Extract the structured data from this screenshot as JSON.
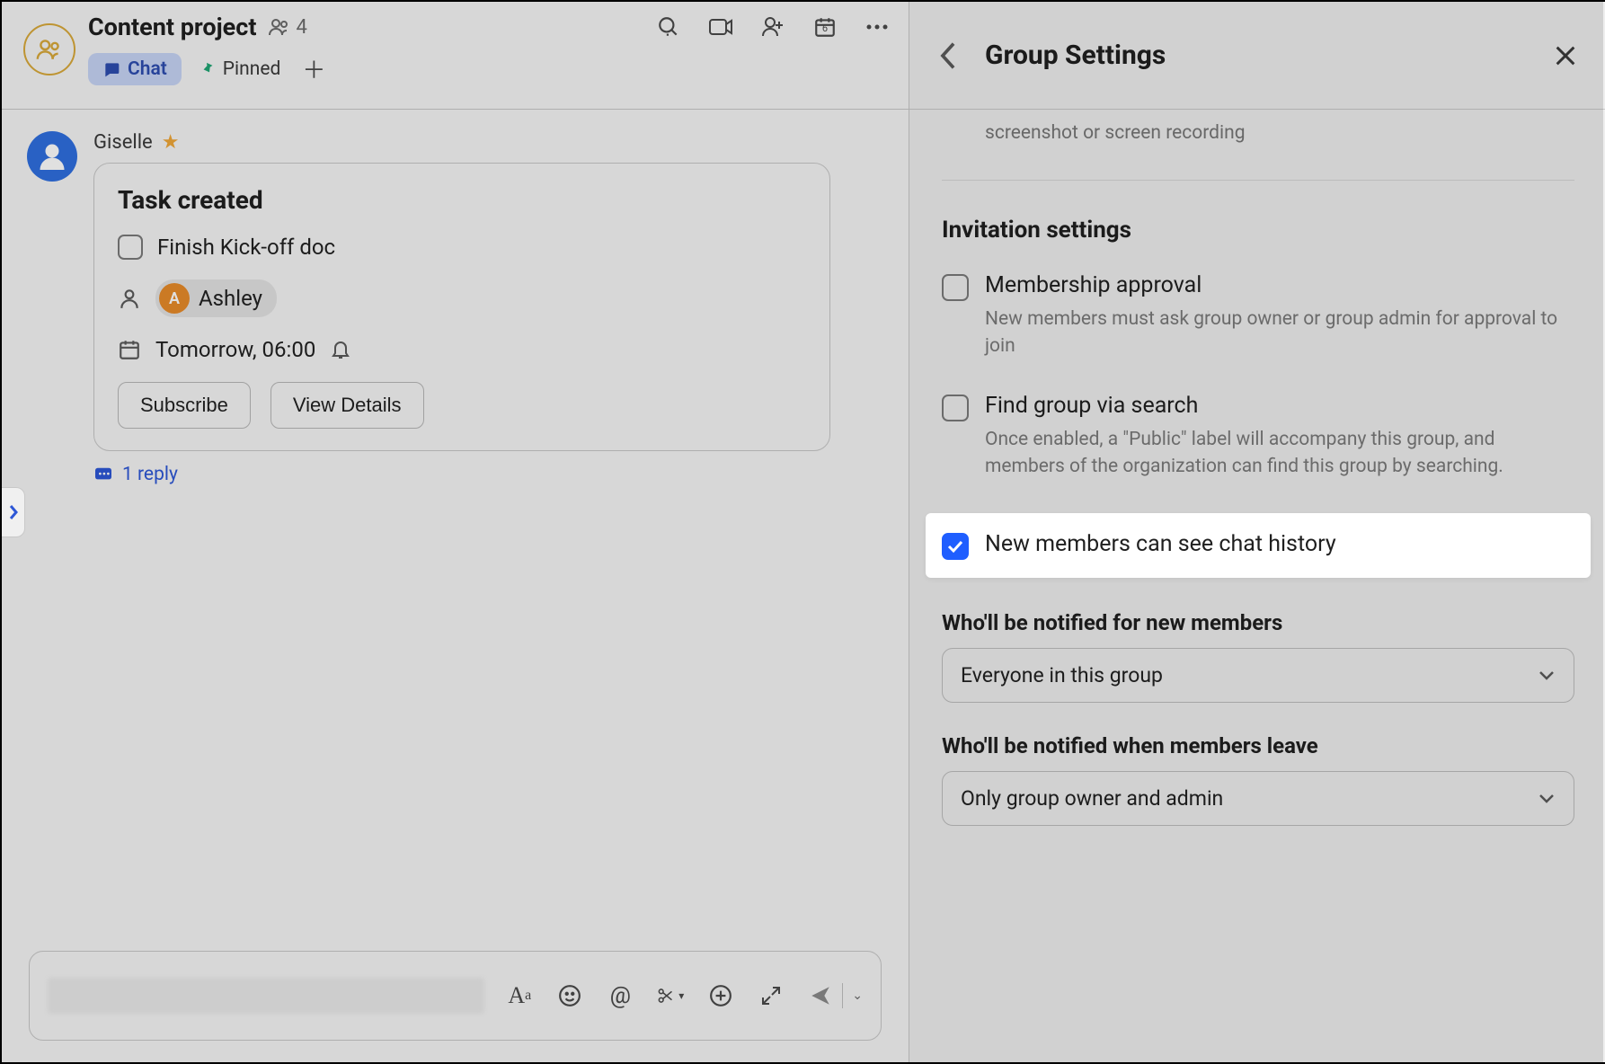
{
  "header": {
    "group_name": "Content project",
    "member_count": "4",
    "tabs": {
      "chat": "Chat",
      "pinned": "Pinned"
    },
    "calendar_badge": "6"
  },
  "message": {
    "author": "Giselle",
    "task_card": {
      "title": "Task created",
      "task_name": "Finish Kick-off doc",
      "assignee": {
        "initial": "A",
        "name": "Ashley"
      },
      "due": "Tomorrow, 06:00",
      "buttons": {
        "subscribe": "Subscribe",
        "details": "View Details"
      }
    },
    "reply": "1 reply"
  },
  "settings": {
    "panel_title": "Group Settings",
    "top_desc": "screenshot or screen recording",
    "section_title": "Invitation settings",
    "membership": {
      "label": "Membership approval",
      "sub": "New members must ask group owner or group admin for approval to join"
    },
    "find_search": {
      "label": "Find group via search",
      "sub": "Once enabled, a \"Public\" label will accompany this group, and members of the organization can find this group by searching."
    },
    "history": {
      "label": "New members can see chat history"
    },
    "notify_new": {
      "title": "Who'll be notified for new members",
      "value": "Everyone in this group"
    },
    "notify_leave": {
      "title": "Who'll be notified when members leave",
      "value": "Only group owner and admin"
    }
  }
}
